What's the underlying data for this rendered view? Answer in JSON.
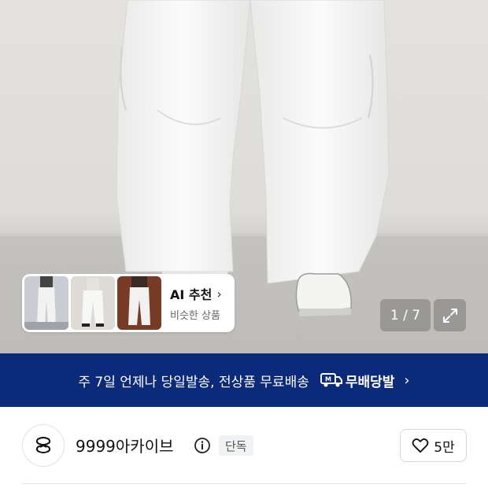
{
  "gallery": {
    "image_alt": "white wide pants product photo",
    "counter": "1 / 7",
    "expand_icon": "expand-arrows-icon"
  },
  "ai_recommend": {
    "title": "AI 추천",
    "subtitle": "비슷한 상품",
    "chevron": "›"
  },
  "banner": {
    "text": "주 7일 언제나 당일발송, 전상품 무료배송",
    "brand": "무배당발",
    "chevron": "›",
    "background": "#0b2a7a"
  },
  "store": {
    "name": "9999아카이브",
    "badge": "단독",
    "like_count": "5만"
  }
}
